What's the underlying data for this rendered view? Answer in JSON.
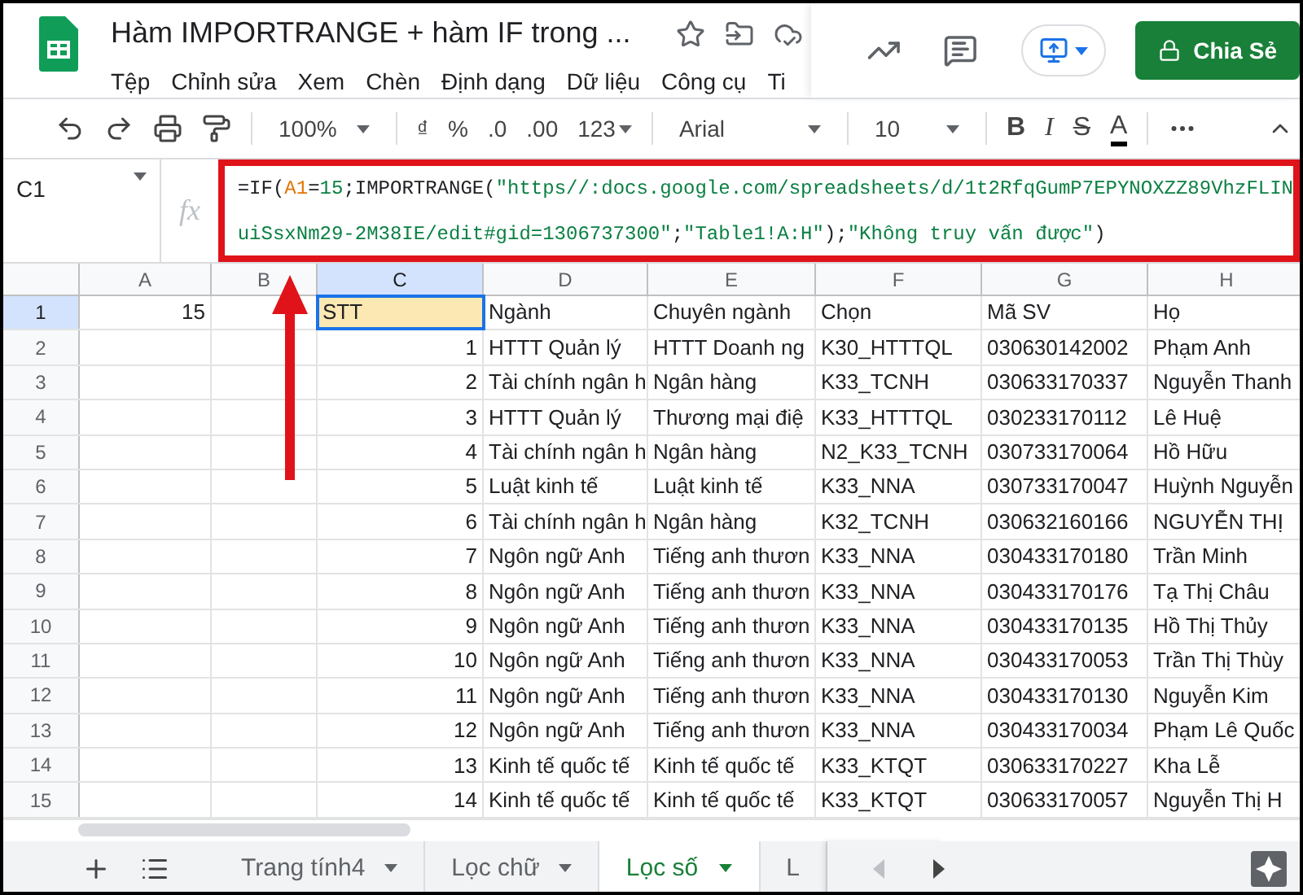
{
  "app": {
    "title": "Hàm IMPORTRANGE + hàm IF trong ...",
    "menu": [
      "Tệp",
      "Chỉnh sửa",
      "Xem",
      "Chèn",
      "Định dạng",
      "Dữ liệu",
      "Công cụ",
      "Ti"
    ],
    "share_button": "Chia Sẻ"
  },
  "toolbar": {
    "zoom": "100%",
    "currency": "₫",
    "percent": "%",
    "decimal_less": ".0",
    "decimal_more": ".00",
    "format": "123",
    "font": "Arial",
    "size": "10",
    "bold": "B",
    "italic": "I",
    "strike": "S",
    "text_color": "A"
  },
  "formula_bar": {
    "name_box": "C1",
    "fx": "fx",
    "lines": [
      [
        {
          "text": "=IF(",
          "kind": "plain"
        },
        {
          "text": "A1",
          "kind": "ref"
        },
        {
          "text": "=",
          "kind": "plain"
        },
        {
          "text": "15",
          "kind": "number"
        },
        {
          "text": ";IMPORTRANGE(",
          "kind": "plain"
        },
        {
          "text": "\"https//:docs.google.com/spreadsheets/d/1t2RfqGumP7EPYNOXZZ89VhzFLIN",
          "kind": "string"
        }
      ],
      [
        {
          "text": "uiSsxNm29-2M38IE/edit#gid=1306737300\"",
          "kind": "string"
        },
        {
          "text": ";",
          "kind": "plain"
        },
        {
          "text": "\"Table1!A:H\"",
          "kind": "string"
        },
        {
          "text": ");",
          "kind": "plain"
        },
        {
          "text": "\"Không truy vấn được\"",
          "kind": "string"
        },
        {
          "text": ")",
          "kind": "plain"
        }
      ]
    ]
  },
  "sheet": {
    "columns": [
      {
        "label": "A",
        "selected": false
      },
      {
        "label": "B",
        "selected": false
      },
      {
        "label": "C",
        "selected": true
      },
      {
        "label": "D",
        "selected": false
      },
      {
        "label": "E",
        "selected": false
      },
      {
        "label": "F",
        "selected": false
      },
      {
        "label": "G",
        "selected": false
      },
      {
        "label": "H",
        "selected": false
      }
    ],
    "rows": [
      {
        "number": "1",
        "selected": true,
        "cells": {
          "A": {
            "text": "15",
            "kind": "number",
            "selected": false
          },
          "C": {
            "text": "STT",
            "kind": "text",
            "selected": true
          },
          "D": {
            "text": "Ngành",
            "kind": "text",
            "selected": false
          },
          "E": {
            "text": "Chuyên ngành",
            "kind": "text",
            "selected": false
          },
          "F": {
            "text": "Chọn",
            "kind": "text",
            "selected": false
          },
          "G": {
            "text": "Mã SV",
            "kind": "text",
            "selected": false
          },
          "H": {
            "text": "Họ",
            "kind": "text",
            "selected": false
          }
        }
      },
      {
        "number": "2",
        "selected": false,
        "cells": {
          "C": {
            "text": "1",
            "kind": "number",
            "selected": false
          },
          "D": {
            "text": "HTTT Quản lý",
            "kind": "text",
            "selected": false
          },
          "E": {
            "text": "HTTT Doanh ng",
            "kind": "text",
            "selected": false
          },
          "F": {
            "text": "K30_HTTTQL",
            "kind": "text",
            "selected": false
          },
          "G": {
            "text": "030630142002",
            "kind": "text",
            "selected": false
          },
          "H": {
            "text": "Phạm Anh",
            "kind": "text",
            "selected": false
          }
        }
      },
      {
        "number": "3",
        "selected": false,
        "cells": {
          "C": {
            "text": "2",
            "kind": "number",
            "selected": false
          },
          "D": {
            "text": "Tài chính ngân h",
            "kind": "text",
            "selected": false
          },
          "E": {
            "text": "Ngân hàng",
            "kind": "text",
            "selected": false
          },
          "F": {
            "text": "K33_TCNH",
            "kind": "text",
            "selected": false
          },
          "G": {
            "text": "030633170337",
            "kind": "text",
            "selected": false
          },
          "H": {
            "text": "Nguyễn Thanh",
            "kind": "text",
            "selected": false
          }
        }
      },
      {
        "number": "4",
        "selected": false,
        "cells": {
          "C": {
            "text": "3",
            "kind": "number",
            "selected": false
          },
          "D": {
            "text": "HTTT Quản lý",
            "kind": "text",
            "selected": false
          },
          "E": {
            "text": "Thương mại điệ",
            "kind": "text",
            "selected": false
          },
          "F": {
            "text": "K33_HTTTQL",
            "kind": "text",
            "selected": false
          },
          "G": {
            "text": "030233170112",
            "kind": "text",
            "selected": false
          },
          "H": {
            "text": "Lê Huệ",
            "kind": "text",
            "selected": false
          }
        }
      },
      {
        "number": "5",
        "selected": false,
        "cells": {
          "C": {
            "text": "4",
            "kind": "number",
            "selected": false
          },
          "D": {
            "text": "Tài chính ngân h",
            "kind": "text",
            "selected": false
          },
          "E": {
            "text": "Ngân hàng",
            "kind": "text",
            "selected": false
          },
          "F": {
            "text": "N2_K33_TCNH",
            "kind": "text",
            "selected": false
          },
          "G": {
            "text": "030733170064",
            "kind": "text",
            "selected": false
          },
          "H": {
            "text": "Hồ Hữu",
            "kind": "text",
            "selected": false
          }
        }
      },
      {
        "number": "6",
        "selected": false,
        "cells": {
          "C": {
            "text": "5",
            "kind": "number",
            "selected": false
          },
          "D": {
            "text": "Luật kinh tế",
            "kind": "text",
            "selected": false
          },
          "E": {
            "text": "Luật kinh tế",
            "kind": "text",
            "selected": false
          },
          "F": {
            "text": "K33_NNA",
            "kind": "text",
            "selected": false
          },
          "G": {
            "text": "030733170047",
            "kind": "text",
            "selected": false
          },
          "H": {
            "text": "Huỳnh Nguyễn",
            "kind": "text",
            "selected": false
          }
        }
      },
      {
        "number": "7",
        "selected": false,
        "cells": {
          "C": {
            "text": "6",
            "kind": "number",
            "selected": false
          },
          "D": {
            "text": "Tài chính ngân h",
            "kind": "text",
            "selected": false
          },
          "E": {
            "text": "Ngân hàng",
            "kind": "text",
            "selected": false
          },
          "F": {
            "text": "K32_TCNH",
            "kind": "text",
            "selected": false
          },
          "G": {
            "text": "030632160166",
            "kind": "text",
            "selected": false
          },
          "H": {
            "text": "NGUYỄN THỊ",
            "kind": "text",
            "selected": false
          }
        }
      },
      {
        "number": "8",
        "selected": false,
        "cells": {
          "C": {
            "text": "7",
            "kind": "number",
            "selected": false
          },
          "D": {
            "text": "Ngôn ngữ Anh",
            "kind": "text",
            "selected": false
          },
          "E": {
            "text": "Tiếng anh thươn",
            "kind": "text",
            "selected": false
          },
          "F": {
            "text": "K33_NNA",
            "kind": "text",
            "selected": false
          },
          "G": {
            "text": "030433170180",
            "kind": "text",
            "selected": false
          },
          "H": {
            "text": "Trần Minh",
            "kind": "text",
            "selected": false
          }
        }
      },
      {
        "number": "9",
        "selected": false,
        "cells": {
          "C": {
            "text": "8",
            "kind": "number",
            "selected": false
          },
          "D": {
            "text": "Ngôn ngữ Anh",
            "kind": "text",
            "selected": false
          },
          "E": {
            "text": "Tiếng anh thươn",
            "kind": "text",
            "selected": false
          },
          "F": {
            "text": "K33_NNA",
            "kind": "text",
            "selected": false
          },
          "G": {
            "text": "030433170176",
            "kind": "text",
            "selected": false
          },
          "H": {
            "text": "Tạ Thị Châu",
            "kind": "text",
            "selected": false
          }
        }
      },
      {
        "number": "10",
        "selected": false,
        "cells": {
          "C": {
            "text": "9",
            "kind": "number",
            "selected": false
          },
          "D": {
            "text": "Ngôn ngữ Anh",
            "kind": "text",
            "selected": false
          },
          "E": {
            "text": "Tiếng anh thươn",
            "kind": "text",
            "selected": false
          },
          "F": {
            "text": "K33_NNA",
            "kind": "text",
            "selected": false
          },
          "G": {
            "text": "030433170135",
            "kind": "text",
            "selected": false
          },
          "H": {
            "text": "Hồ Thị Thủy",
            "kind": "text",
            "selected": false
          }
        }
      },
      {
        "number": "11",
        "selected": false,
        "cells": {
          "C": {
            "text": "10",
            "kind": "number",
            "selected": false
          },
          "D": {
            "text": "Ngôn ngữ Anh",
            "kind": "text",
            "selected": false
          },
          "E": {
            "text": "Tiếng anh thươn",
            "kind": "text",
            "selected": false
          },
          "F": {
            "text": "K33_NNA",
            "kind": "text",
            "selected": false
          },
          "G": {
            "text": "030433170053",
            "kind": "text",
            "selected": false
          },
          "H": {
            "text": "Trần Thị Thùy",
            "kind": "text",
            "selected": false
          }
        }
      },
      {
        "number": "12",
        "selected": false,
        "cells": {
          "C": {
            "text": "11",
            "kind": "number",
            "selected": false
          },
          "D": {
            "text": "Ngôn ngữ Anh",
            "kind": "text",
            "selected": false
          },
          "E": {
            "text": "Tiếng anh thươn",
            "kind": "text",
            "selected": false
          },
          "F": {
            "text": "K33_NNA",
            "kind": "text",
            "selected": false
          },
          "G": {
            "text": "030433170130",
            "kind": "text",
            "selected": false
          },
          "H": {
            "text": "Nguyễn Kim",
            "kind": "text",
            "selected": false
          }
        }
      },
      {
        "number": "13",
        "selected": false,
        "cells": {
          "C": {
            "text": "12",
            "kind": "number",
            "selected": false
          },
          "D": {
            "text": "Ngôn ngữ Anh",
            "kind": "text",
            "selected": false
          },
          "E": {
            "text": "Tiếng anh thươn",
            "kind": "text",
            "selected": false
          },
          "F": {
            "text": "K33_NNA",
            "kind": "text",
            "selected": false
          },
          "G": {
            "text": "030433170034",
            "kind": "text",
            "selected": false
          },
          "H": {
            "text": "Phạm Lê Quốc",
            "kind": "text",
            "selected": false
          }
        }
      },
      {
        "number": "14",
        "selected": false,
        "cells": {
          "C": {
            "text": "13",
            "kind": "number",
            "selected": false
          },
          "D": {
            "text": "Kinh tế quốc tế",
            "kind": "text",
            "selected": false
          },
          "E": {
            "text": "Kinh tế quốc tế",
            "kind": "text",
            "selected": false
          },
          "F": {
            "text": "K33_KTQT",
            "kind": "text",
            "selected": false
          },
          "G": {
            "text": "030633170227",
            "kind": "text",
            "selected": false
          },
          "H": {
            "text": "Kha Lễ",
            "kind": "text",
            "selected": false
          }
        }
      },
      {
        "number": "15",
        "selected": false,
        "cells": {
          "C": {
            "text": "14",
            "kind": "number",
            "selected": false
          },
          "D": {
            "text": "Kinh tế quốc tế",
            "kind": "text",
            "selected": false
          },
          "E": {
            "text": "Kinh tế quốc tế",
            "kind": "text",
            "selected": false
          },
          "F": {
            "text": "K33_KTQT",
            "kind": "text",
            "selected": false
          },
          "G": {
            "text": "030633170057",
            "kind": "text",
            "selected": false
          },
          "H": {
            "text": "Nguyễn Thị H",
            "kind": "text",
            "selected": false
          }
        }
      }
    ]
  },
  "sheet_tabs": [
    {
      "label": "Trang tính4",
      "selected": false
    },
    {
      "label": "Lọc chữ",
      "selected": false
    },
    {
      "label": "Lọc số",
      "selected": true
    },
    {
      "label": "L",
      "selected": false
    }
  ]
}
